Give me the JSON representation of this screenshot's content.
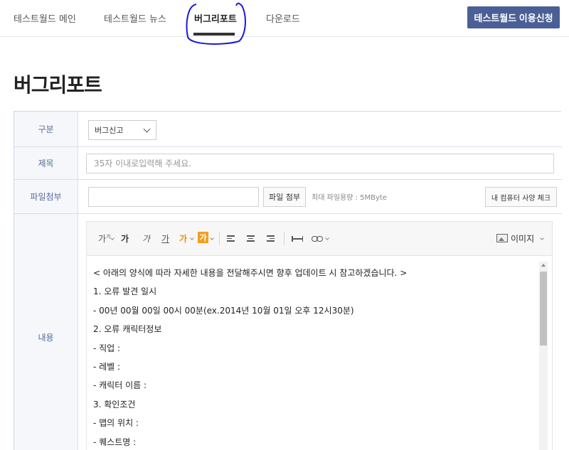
{
  "nav": {
    "tabs": [
      {
        "label": "테스트월드 메인"
      },
      {
        "label": "테스트월드 뉴스"
      },
      {
        "label": "버그리포트"
      },
      {
        "label": "다운로드"
      }
    ],
    "active_tab": "버그리포트",
    "apply_button": "테스트월드 이용신청"
  },
  "page": {
    "title": "버그리포트"
  },
  "form": {
    "category": {
      "label": "구분",
      "selected": "버그신고"
    },
    "subject": {
      "label": "제목",
      "placeholder": "35자 이내로입력해 주세요."
    },
    "attachment": {
      "label": "파일첨부",
      "attach_button": "파일 첨부",
      "size_note": "최대 파일용량 : 5MByte",
      "pc_check_button": "내 컴퓨터 사양 체크"
    },
    "content": {
      "label": "내용",
      "toolbar": {
        "font_size": "가",
        "bold": "가",
        "italic": "가",
        "underline": "가",
        "text_color": "가",
        "bg_color": "가",
        "image_button": "이미지"
      },
      "lines": [
        "< 아래의 양식에 따라 자세한 내용을 전달해주시면 향후 업데이트 시 참고하겠습니다. >",
        "1. 오류 발견 일시",
        "- 00년 00월 00일 00시 00분(ex.2014년 10월 01일 오후 12시30분)",
        "2. 오류 캐릭터정보",
        "- 직업 :",
        "- 레벨 :",
        "- 캐릭터 이름 :",
        "3. 확인조건",
        "- 맵의 위치 :",
        "- 퀘스트명 :"
      ]
    }
  },
  "colors": {
    "accent": "#4a5f96",
    "label_text": "#5a6b99",
    "highlight": "#f0a020",
    "annotation": "#1a1ad6"
  }
}
